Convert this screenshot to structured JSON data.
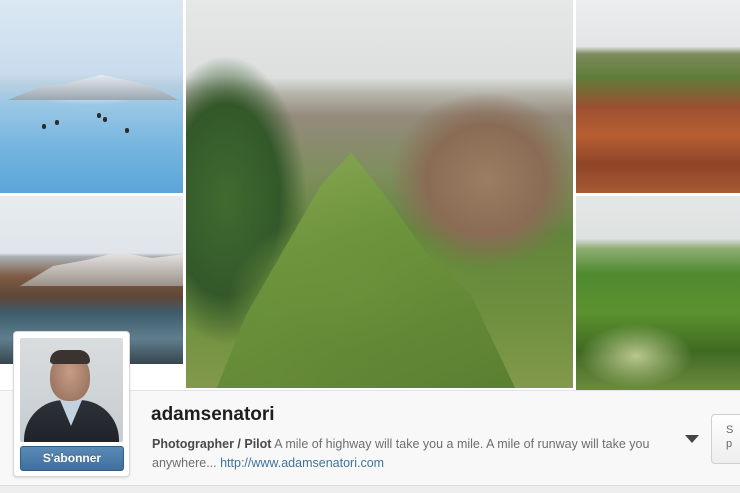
{
  "profile": {
    "username": "adamsenatori",
    "follow_label": "S'abonner",
    "bio_title": "Photographer / Pilot",
    "bio_text": " A mile of highway will take you a mile. A mile of runway will take you anywhere... ",
    "website": "http://www.adamsenatori.com"
  },
  "side_button": {
    "line1": "S",
    "line2": "p"
  },
  "gallery": {
    "tiles": [
      {
        "subject": "geothermal lagoon with bathers"
      },
      {
        "subject": "river and snowy mountains"
      },
      {
        "subject": "aerial green mountain ridge"
      },
      {
        "subject": "red canyon aerial"
      },
      {
        "subject": "green valley aerial"
      }
    ]
  },
  "icons": {
    "dropdown": "caret-down-icon"
  },
  "colors": {
    "follow_button": "#3f6f9e",
    "link": "#3f729b"
  }
}
